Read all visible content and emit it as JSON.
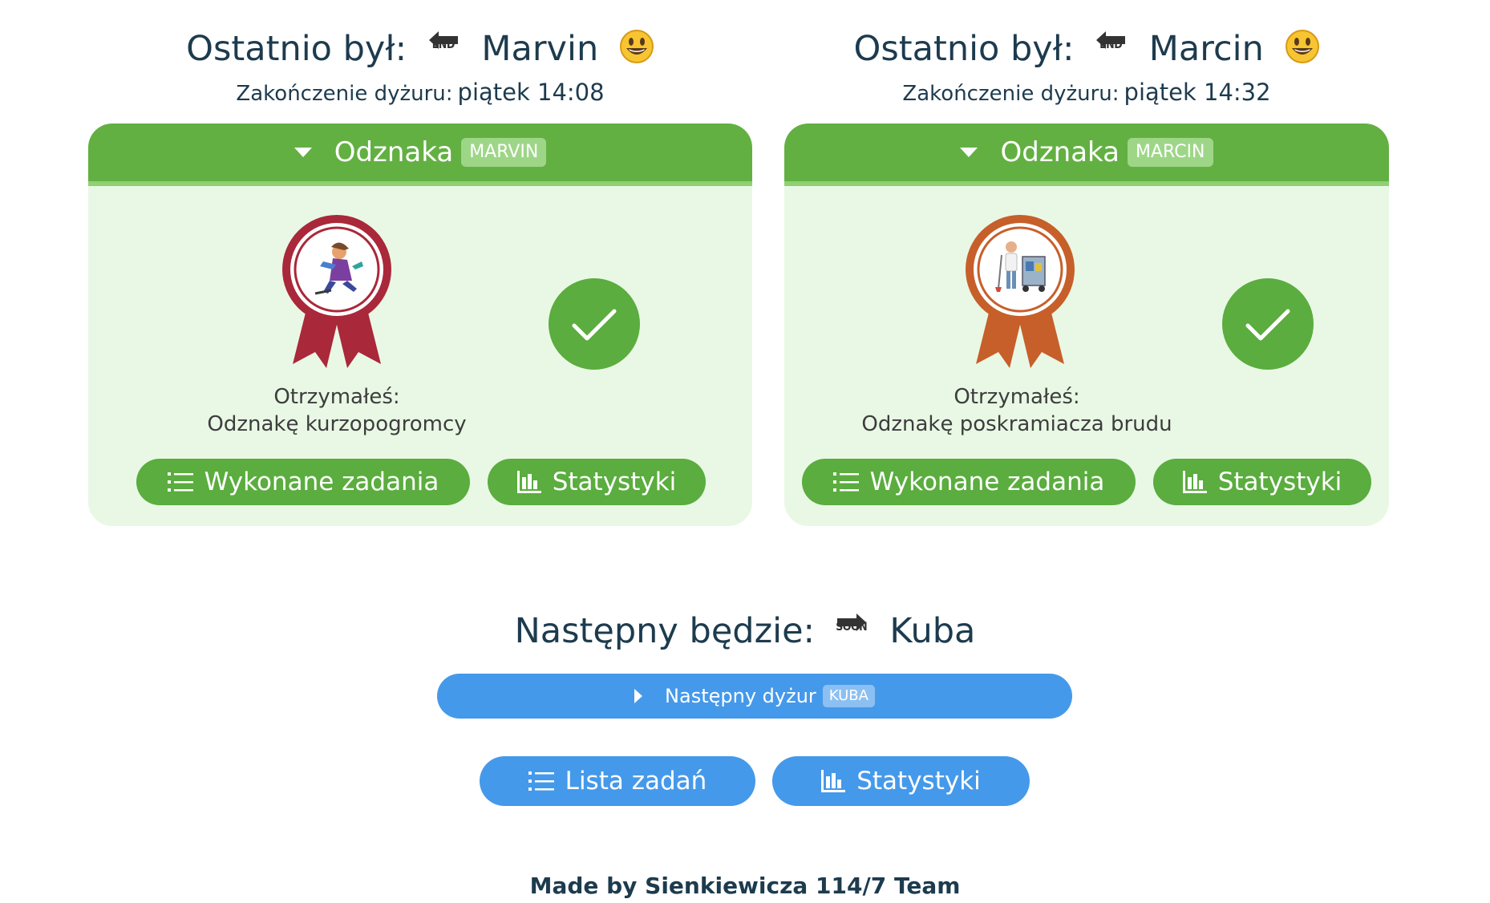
{
  "left": {
    "last_label": "Ostatnio był:",
    "arrow_tag": "END",
    "name": "Marvin",
    "end_label": "Zakończenie dyżuru:",
    "end_value": "piątek 14:08",
    "badge_header": "Odznaka",
    "badge_pill": "MARVIN",
    "received_label": "Otrzymałeś:",
    "received_badge": "Odznakę kurzopogromcy",
    "tasks_button": "Wykonane zadania",
    "stats_button": "Statystyki",
    "ribbon_color": "#a92839"
  },
  "right": {
    "last_label": "Ostatnio był:",
    "arrow_tag": "END",
    "name": "Marcin",
    "end_label": "Zakończenie dyżuru:",
    "end_value": "piątek 14:32",
    "badge_header": "Odznaka",
    "badge_pill": "MARCIN",
    "received_label": "Otrzymałeś:",
    "received_badge": "Odznakę poskramiacza brudu",
    "tasks_button": "Wykonane zadania",
    "stats_button": "Statystyki",
    "ribbon_color": "#c75f2a"
  },
  "next": {
    "label": "Następny będzie:",
    "arrow_tag": "SOON",
    "name": "Kuba",
    "bar_label": "Następny dyżur",
    "bar_pill": "KUBA",
    "list_button": "Lista zadań",
    "stats_button": "Statystyki"
  },
  "footer": "Made by Sienkiewicza 114/7 Team",
  "colors": {
    "green": "#5aad3e",
    "green_light": "#e9f8e5",
    "blue": "#4599ea",
    "text": "#1d3b4e"
  },
  "icons": [
    "back-arrow-end-icon",
    "smiley-icon",
    "caret-down-icon",
    "award-badge-icon",
    "check-icon",
    "list-icon",
    "bar-chart-icon",
    "caret-right-icon",
    "soon-arrow-icon"
  ]
}
